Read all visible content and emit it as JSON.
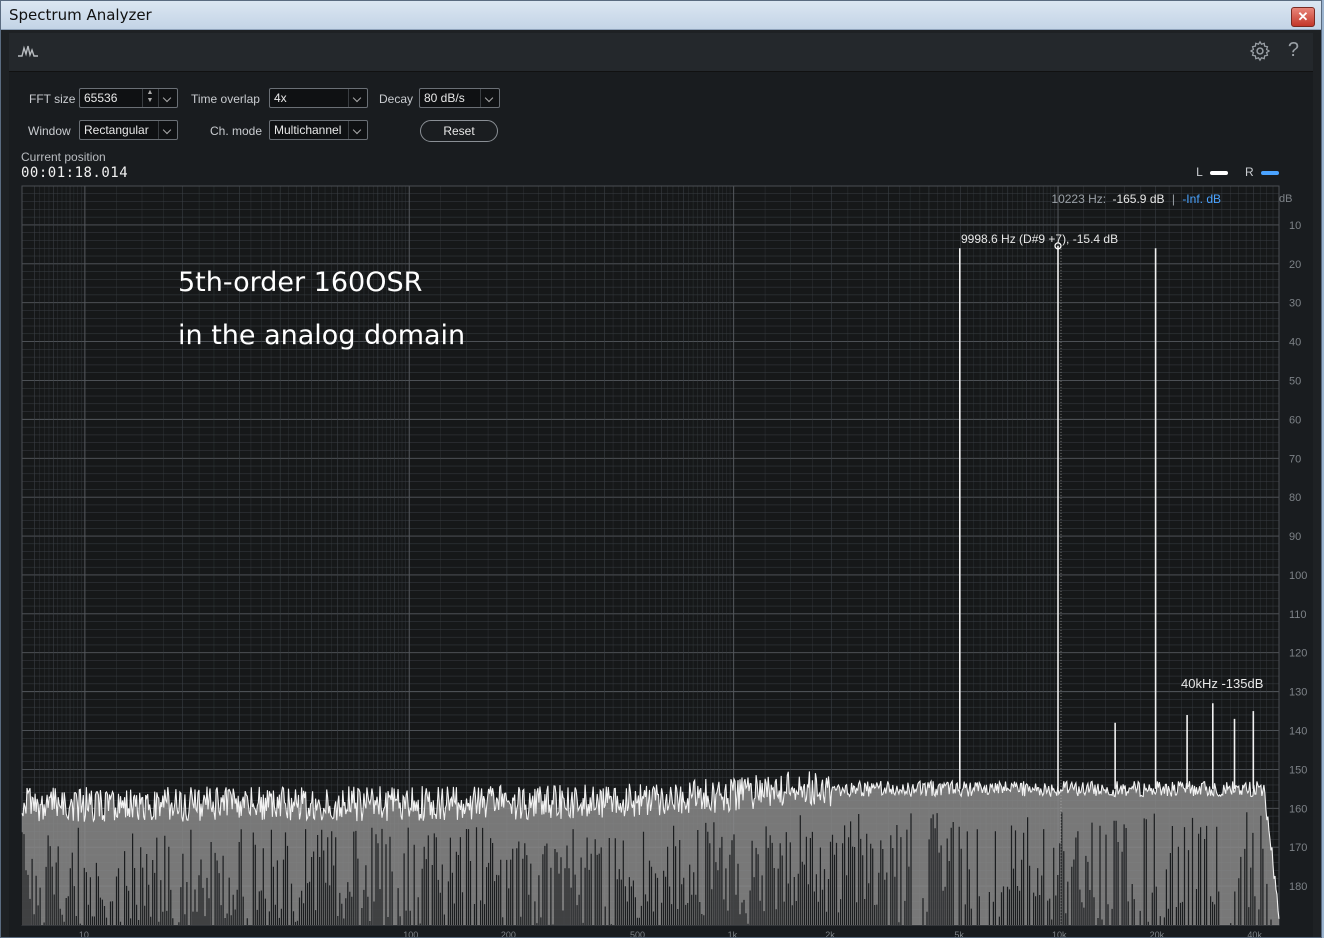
{
  "window": {
    "title": "Spectrum Analyzer",
    "close_label": "✕"
  },
  "header": {
    "app_icon": "waveform-icon",
    "settings_icon": "gear-icon",
    "help_label": "?"
  },
  "controls": {
    "fft_size": {
      "label": "FFT size",
      "value": "65536"
    },
    "time_overlap": {
      "label": "Time overlap",
      "value": "4x"
    },
    "decay": {
      "label": "Decay",
      "value": "80 dB/s"
    },
    "window": {
      "label": "Window",
      "value": "Rectangular"
    },
    "ch_mode": {
      "label": "Ch. mode",
      "value": "Multichannel"
    },
    "reset_label": "Reset"
  },
  "position": {
    "label": "Current position",
    "value": "00:01:18.014"
  },
  "legend": {
    "left_label": "L",
    "right_label": "R",
    "left_color": "#ffffff",
    "right_color": "#4aa3ff"
  },
  "readout": {
    "freq": "10223 Hz:",
    "value": "-165.9 dB",
    "sep": "|",
    "right_value": "-Inf. dB",
    "unit": "dB"
  },
  "annotations": {
    "line1": "5th-order 160OSR",
    "line2": "in the analog domain",
    "peak_label": "9998.6 Hz (D#9 +7), -15.4 dB",
    "note_40k": "40kHz -135dB"
  },
  "chart_data": {
    "type": "line",
    "x_scale": "log",
    "xlim": [
      6.4,
      48000
    ],
    "ylim": [
      0,
      -190
    ],
    "x_ticks": [
      "10",
      "100",
      "200",
      "500",
      "1k",
      "2k",
      "5k",
      "10k",
      "20k",
      "40k"
    ],
    "y_ticks": [
      "10",
      "20",
      "30",
      "40",
      "50",
      "60",
      "70",
      "80",
      "90",
      "100",
      "110",
      "120",
      "130",
      "140",
      "150",
      "160",
      "170",
      "180"
    ],
    "y_tick_values": [
      -10,
      -20,
      -30,
      -40,
      -50,
      -60,
      -70,
      -80,
      -90,
      -100,
      -110,
      -120,
      -130,
      -140,
      -150,
      -160,
      -170,
      -180
    ],
    "noise_floor_db": -155,
    "peaks": [
      {
        "freq": 4980,
        "db": -16
      },
      {
        "freq": 9998.6,
        "db": -15.4
      },
      {
        "freq": 19990,
        "db": -16
      },
      {
        "freq": 15000,
        "db": -138
      },
      {
        "freq": 25000,
        "db": -136
      },
      {
        "freq": 30000,
        "db": -133
      },
      {
        "freq": 35000,
        "db": -137
      },
      {
        "freq": 40000,
        "db": -135
      }
    ],
    "marker": {
      "freq": 9998.6,
      "db": -15.4
    },
    "colors": {
      "trace": "#f2f2f2",
      "fill": "#8a8a8a",
      "grid": "#3a3f44",
      "grid_major": "#55595e",
      "background": "#161819"
    }
  }
}
